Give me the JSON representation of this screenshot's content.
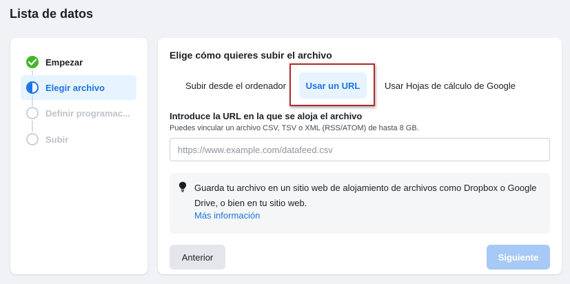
{
  "page": {
    "title": "Lista de datos"
  },
  "steps": [
    {
      "label": "Empezar",
      "state": "done"
    },
    {
      "label": "Elegir archivo",
      "state": "active"
    },
    {
      "label": "Definir programac...",
      "state": "pending"
    },
    {
      "label": "Subir",
      "state": "pending"
    }
  ],
  "card": {
    "title": "Elige cómo quieres subir el archivo",
    "tabs": [
      {
        "label": "Subir desde el ordenador",
        "active": false
      },
      {
        "label": "Usar un URL",
        "active": true
      },
      {
        "label": "Usar Hojas de cálculo de Google",
        "active": false
      }
    ],
    "url_label": "Introduce la URL en la que se aloja el archivo",
    "url_help": "Puedes vincular un archivo CSV, TSV o XML (RSS/ATOM) de hasta 8 GB.",
    "url_input": {
      "value": "",
      "placeholder": "https://www.example.com/datafeed.csv"
    },
    "info": {
      "text": "Guarda tu archivo en un sitio web de alojamiento de archivos como Dropbox o Google Drive, o bien en tu sitio web.",
      "link": "Más información",
      "icon": "lightbulb-icon"
    },
    "back_button": "Anterior",
    "next_button": "Siguiente"
  },
  "colors": {
    "accent": "#1b74e4",
    "success": "#42b72a",
    "highlight_frame": "#b22a2a",
    "next_disabled": "#a7c9f5"
  }
}
